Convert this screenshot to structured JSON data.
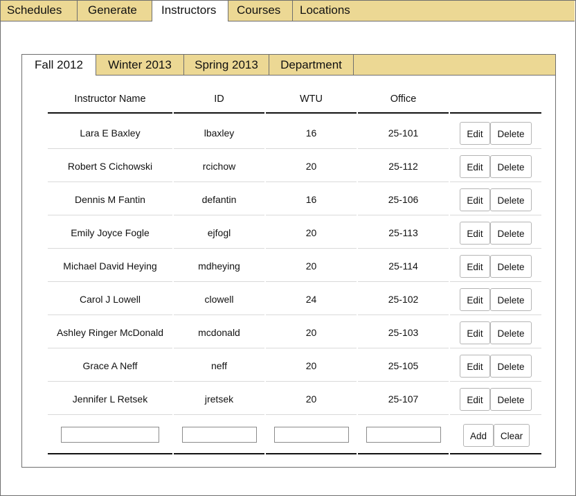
{
  "top_tabs": [
    {
      "label": "Schedules"
    },
    {
      "label": "Generate"
    },
    {
      "label": "Instructors",
      "active": true
    },
    {
      "label": "Courses"
    },
    {
      "label": "Locations"
    }
  ],
  "sub_tabs": [
    {
      "label": "Fall 2012",
      "active": true
    },
    {
      "label": "Winter 2013"
    },
    {
      "label": "Spring 2013"
    },
    {
      "label": "Department"
    }
  ],
  "table": {
    "headers": [
      "Instructor Name",
      "ID",
      "WTU",
      "Office"
    ],
    "rows": [
      {
        "name": "Lara E Baxley",
        "id": "lbaxley",
        "wtu": "16",
        "office": "25-101"
      },
      {
        "name": "Robert S Cichowski",
        "id": "rcichow",
        "wtu": "20",
        "office": "25-112"
      },
      {
        "name": "Dennis M Fantin",
        "id": "defantin",
        "wtu": "16",
        "office": "25-106"
      },
      {
        "name": "Emily Joyce Fogle",
        "id": "ejfogl",
        "wtu": "20",
        "office": "25-113"
      },
      {
        "name": "Michael David Heying",
        "id": "mdheying",
        "wtu": "20",
        "office": "25-114"
      },
      {
        "name": "Carol J Lowell",
        "id": "clowell",
        "wtu": "24",
        "office": "25-102"
      },
      {
        "name": "Ashley Ringer McDonald",
        "id": "mcdonald",
        "wtu": "20",
        "office": "25-103"
      },
      {
        "name": "Grace A Neff",
        "id": "neff",
        "wtu": "20",
        "office": "25-105"
      },
      {
        "name": "Jennifer L Retsek",
        "id": "jretsek",
        "wtu": "20",
        "office": "25-107"
      }
    ],
    "edit_label": "Edit",
    "delete_label": "Delete"
  },
  "new_row": {
    "name_value": "",
    "id_value": "",
    "wtu_value": "",
    "office_value": "",
    "add_label": "Add",
    "clear_label": "Clear"
  },
  "colors": {
    "tab_background": "#ecd894",
    "border": "#6e6e6e"
  }
}
